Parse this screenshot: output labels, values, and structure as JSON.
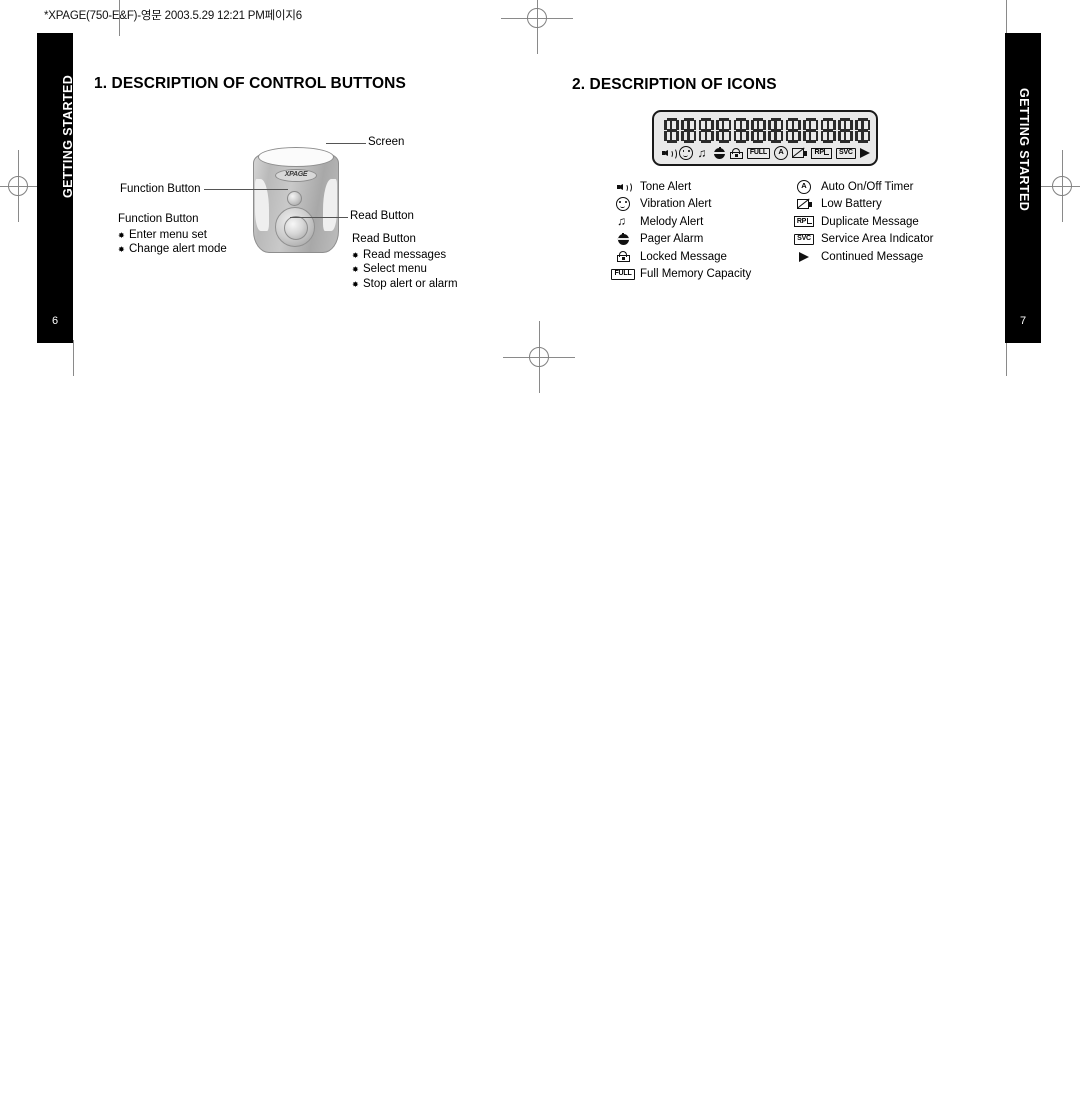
{
  "print_header": "*XPAGE(750-E&F)-영문  2003.5.29 12:21 PM페이지6",
  "left_page": {
    "tab_label": "GETTING STARTED",
    "page_number": "6",
    "section_title": "1. DESCRIPTION OF CONTROL BUTTONS",
    "device": {
      "logo": "XPAGE"
    },
    "callouts": {
      "screen": "Screen",
      "function_button": "Function Button",
      "read_button": "Read Button"
    },
    "notes": [
      {
        "title": "Function Button",
        "items": [
          "Enter menu set",
          "Change alert mode"
        ]
      },
      {
        "title": "Read Button",
        "items": [
          "Read messages",
          "Select menu",
          "Stop alert or alarm"
        ]
      }
    ]
  },
  "right_page": {
    "tab_label": "GETTING STARTED",
    "page_number": "7",
    "section_title": "2. DESCRIPTION OF ICONS",
    "lcd": {
      "character_cells": 12,
      "status_icons": [
        "speaker-icon",
        "vibration-icon",
        "melody-icon",
        "bell-icon",
        "lock-icon",
        "full-icon",
        "auto-timer-icon",
        "low-battery-icon",
        "duplicate-icon",
        "service-area-icon",
        "continued-arrow-icon"
      ],
      "badge_labels": {
        "full": "FULL",
        "auto": "A",
        "rp": "RP",
        "svc": "SVC"
      }
    },
    "legend_left": [
      {
        "icon": "speaker-icon",
        "label": "Tone Alert"
      },
      {
        "icon": "vibration-icon",
        "label": "Vibration Alert"
      },
      {
        "icon": "melody-icon",
        "label": "Melody Alert"
      },
      {
        "icon": "bell-icon",
        "label": "Pager Alarm"
      },
      {
        "icon": "lock-icon",
        "label": "Locked Message"
      },
      {
        "icon": "full-icon",
        "label": "Full Memory Capacity"
      }
    ],
    "legend_right": [
      {
        "icon": "auto-timer-icon",
        "label": "Auto On/Off Timer"
      },
      {
        "icon": "low-battery-icon",
        "label": "Low Battery"
      },
      {
        "icon": "duplicate-icon",
        "label": "Duplicate Message"
      },
      {
        "icon": "service-area-icon",
        "label": "Service Area Indicator"
      },
      {
        "icon": "continued-arrow-icon",
        "label": "Continued Message"
      }
    ]
  },
  "colors": {
    "tab_background": "#000000",
    "tab_text": "#ffffff",
    "body_text": "#000000",
    "mark_gray": "#8a8a8a",
    "lcd_background": "#e9e9e9"
  }
}
